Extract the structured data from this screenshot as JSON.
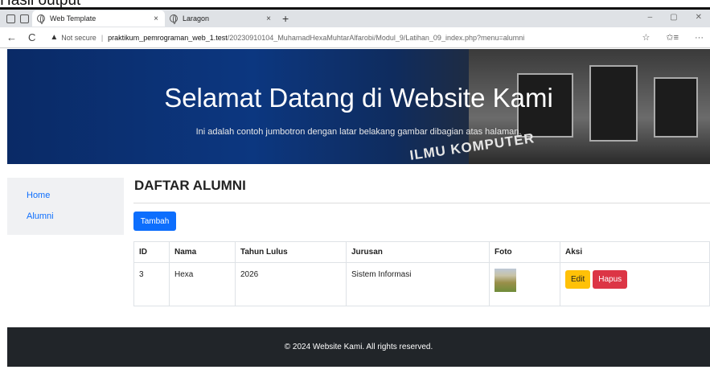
{
  "caption": "Hasil output",
  "browser": {
    "tabs": [
      {
        "title": "Web Template",
        "close": "×"
      },
      {
        "title": "Laragon",
        "close": "×"
      }
    ],
    "new_tab": "+",
    "window_buttons": [
      "–",
      "▢",
      "✕"
    ],
    "nav": {
      "back": "←",
      "refresh": "C"
    },
    "warning": "▲",
    "not_secure": "Not secure",
    "url_host": "praktikum_pemrograman_web_1.test",
    "url_path": "/20230910104_MuhamadHexaMuhtarAlfarobi/Modul_9/Latihan_09_index.php?menu=alumni",
    "right_icons": [
      "☆",
      "✩≡",
      "···"
    ]
  },
  "hero": {
    "title": "Selamat Datang di Website Kami",
    "subtitle": "Ini adalah contoh jumbotron dengan latar belakang gambar dibagian atas halaman.",
    "building_text": "ILMU KOMPUTER"
  },
  "sidebar": {
    "items": [
      {
        "label": "Home"
      },
      {
        "label": "Alumni"
      }
    ]
  },
  "main": {
    "title": "DAFTAR ALUMNI",
    "add_button": "Tambah",
    "table": {
      "headers": [
        "ID",
        "Nama",
        "Tahun Lulus",
        "Jurusan",
        "Foto",
        "Aksi"
      ],
      "rows": [
        {
          "id": "3",
          "nama": "Hexa",
          "tahun": "2026",
          "jurusan": "Sistem Informasi",
          "edit": "Edit",
          "hapus": "Hapus"
        }
      ]
    }
  },
  "footer": {
    "text": "© 2024 Website Kami. All rights reserved."
  },
  "colors": {
    "primary": "#0d6efd",
    "warning": "#ffc107",
    "danger": "#dc3545",
    "footer_bg": "#212529"
  }
}
